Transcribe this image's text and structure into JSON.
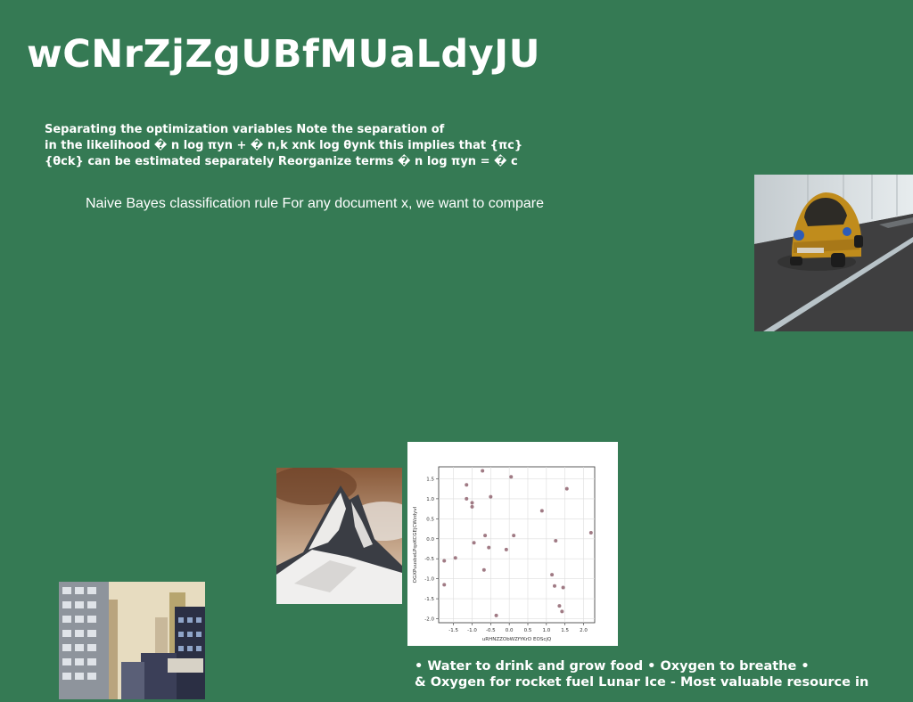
{
  "slide": {
    "title": "wCNrZjZgUBfMUaLdyJU",
    "paragraph_lines": [
      "Separating the optimization variables Note the separation of",
      "in the likelihood � n log πyn + � n,k xnk log θynk this implies that {πc}",
      "{θck} can be estimated separately Reorganize terms � n log πyn = � c"
    ],
    "subtitle": "Naive Bayes classification rule For any document x, we want to compare",
    "bullet_lines": [
      "• Water to drink and grow food • Oxygen to breathe •",
      "& Oxygen for rocket fuel Lunar Ice - Most valuable resource in"
    ],
    "background_color": "#357a54"
  },
  "chart_data": {
    "type": "scatter",
    "xlabel": "uRHNZZObWZfYKrD EOScjQ",
    "ylabel": "OGXPuusbeLPqxKCGEjCWzdyvI",
    "xlim": [
      -1.9,
      2.3
    ],
    "ylim": [
      -2.1,
      1.8
    ],
    "xticks": [
      "-1.5",
      "-1.0",
      "-0.5",
      "0.0",
      "0.5",
      "1.0",
      "1.5",
      "2.0"
    ],
    "xtick_values": [
      -1.5,
      -1.0,
      -0.5,
      0.0,
      0.5,
      1.0,
      1.5,
      2.0
    ],
    "yticks": [
      "1.5",
      "1.0",
      "0.5",
      "0.0",
      "-0.5",
      "-1.0",
      "-1.5",
      "-2.0"
    ],
    "ytick_values": [
      1.5,
      1.0,
      0.5,
      0.0,
      -0.5,
      -1.0,
      -1.5,
      -2.0
    ],
    "grid": true,
    "point_color": "#a07a84",
    "points": [
      {
        "x": -1.75,
        "y": -0.55
      },
      {
        "x": -1.75,
        "y": -1.15
      },
      {
        "x": -1.45,
        "y": -0.48
      },
      {
        "x": -1.15,
        "y": 1.35
      },
      {
        "x": -1.15,
        "y": 1.0
      },
      {
        "x": -1.0,
        "y": 0.9
      },
      {
        "x": -1.0,
        "y": 0.8
      },
      {
        "x": -0.95,
        "y": -0.1
      },
      {
        "x": -0.72,
        "y": 1.7
      },
      {
        "x": -0.68,
        "y": -0.78
      },
      {
        "x": -0.65,
        "y": 0.08
      },
      {
        "x": -0.55,
        "y": -0.22
      },
      {
        "x": -0.5,
        "y": 1.05
      },
      {
        "x": -0.35,
        "y": -1.92
      },
      {
        "x": -0.08,
        "y": -0.27
      },
      {
        "x": 0.05,
        "y": 1.55
      },
      {
        "x": 0.12,
        "y": 0.08
      },
      {
        "x": 0.88,
        "y": 0.7
      },
      {
        "x": 1.15,
        "y": -0.9
      },
      {
        "x": 1.22,
        "y": -1.18
      },
      {
        "x": 1.25,
        "y": -0.05
      },
      {
        "x": 1.35,
        "y": -1.68
      },
      {
        "x": 1.42,
        "y": -1.82
      },
      {
        "x": 1.45,
        "y": -1.22
      },
      {
        "x": 1.55,
        "y": 1.25
      },
      {
        "x": 2.2,
        "y": 0.15
      }
    ]
  }
}
